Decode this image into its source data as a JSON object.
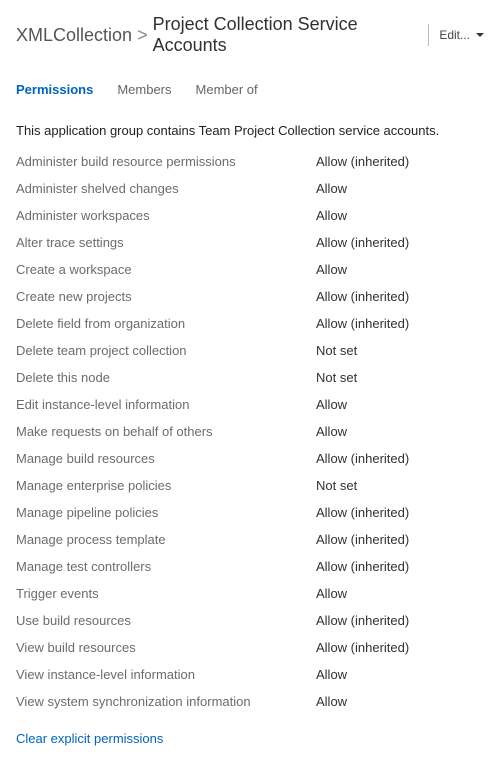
{
  "header": {
    "breadcrumb": [
      "XMLCollection",
      "Project Collection Service Accounts"
    ],
    "separator": ">",
    "edit_label": "Edit..."
  },
  "tabs": [
    {
      "label": "Permissions",
      "active": true
    },
    {
      "label": "Members",
      "active": false
    },
    {
      "label": "Member of",
      "active": false
    }
  ],
  "description": "This application group contains Team Project Collection service accounts.",
  "permissions": [
    {
      "name": "Administer build resource permissions",
      "value": "Allow (inherited)"
    },
    {
      "name": "Administer shelved changes",
      "value": "Allow"
    },
    {
      "name": "Administer workspaces",
      "value": "Allow"
    },
    {
      "name": "Alter trace settings",
      "value": "Allow (inherited)"
    },
    {
      "name": "Create a workspace",
      "value": "Allow"
    },
    {
      "name": "Create new projects",
      "value": "Allow (inherited)"
    },
    {
      "name": "Delete field from organization",
      "value": "Allow (inherited)"
    },
    {
      "name": "Delete team project collection",
      "value": "Not set"
    },
    {
      "name": "Delete this node",
      "value": "Not set"
    },
    {
      "name": "Edit instance-level information",
      "value": "Allow"
    },
    {
      "name": "Make requests on behalf of others",
      "value": "Allow"
    },
    {
      "name": "Manage build resources",
      "value": "Allow (inherited)"
    },
    {
      "name": "Manage enterprise policies",
      "value": "Not set"
    },
    {
      "name": "Manage pipeline policies",
      "value": "Allow (inherited)"
    },
    {
      "name": "Manage process template",
      "value": "Allow (inherited)"
    },
    {
      "name": "Manage test controllers",
      "value": "Allow (inherited)"
    },
    {
      "name": "Trigger events",
      "value": "Allow"
    },
    {
      "name": "Use build resources",
      "value": "Allow (inherited)"
    },
    {
      "name": "View build resources",
      "value": "Allow (inherited)"
    },
    {
      "name": "View instance-level information",
      "value": "Allow"
    },
    {
      "name": "View system synchronization information",
      "value": "Allow"
    }
  ],
  "clear_link_label": "Clear explicit permissions"
}
